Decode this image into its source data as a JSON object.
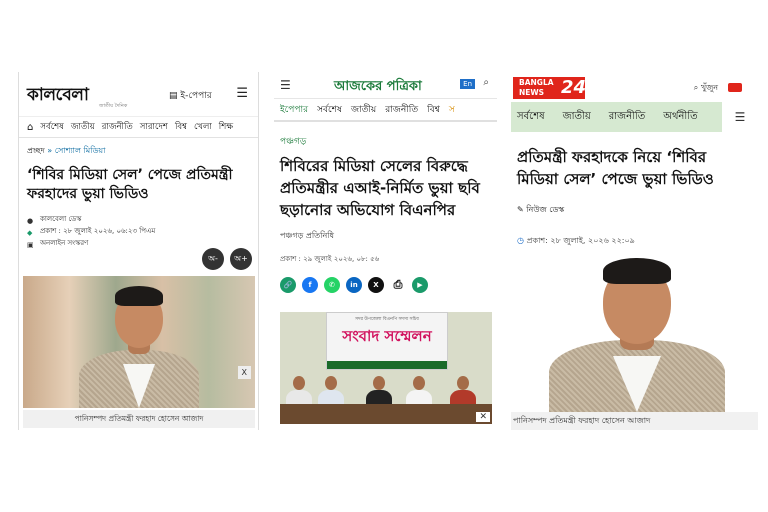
{
  "panels": {
    "kalbela": {
      "logo": "কালবেলা",
      "logo_tag": "জাতীয় দৈনিক",
      "epaper": "ই-পেপার",
      "nav": [
        "সর্বশেষ",
        "জাতীয়",
        "রাজনীতি",
        "সারাদেশ",
        "বিশ্ব",
        "খেলা",
        "শিক্ষ"
      ],
      "breadcrumb_home": "প্রচ্ছদ",
      "breadcrumb_sep": "»",
      "breadcrumb_cat": "সোশ্যাল মিডিয়া",
      "title": "‘শিবির মিডিয়া সেল’ পেজে প্রতিমন্ত্রী ফরহাদের ভুয়া ভিডিও",
      "author": "কালবেলা ডেস্ক",
      "published": "প্রকাশ : ২৮ জুলাই ২০২৬, ০৬:২৩ পিএম",
      "edition": "অনলাইন সংস্করণ",
      "font_minus": "অ-",
      "font_plus": "অ+",
      "close": "X",
      "caption": "পানিসম্পদ প্রতিমন্ত্রী ফরহাদ হোসেন আজাদ"
    },
    "ajker_patrika": {
      "logo": "আজকের পত্রিকা",
      "lang": "En",
      "nav": [
        "ইপেপার",
        "সর্বশেষ",
        "জাতীয়",
        "রাজনীতি",
        "বিশ্ব",
        "স"
      ],
      "category": "পঞ্চগড়",
      "title": "শিবিরের মিডিয়া সেলের বিরুদ্ধে প্রতিমন্ত্রীর এআই-নির্মিত ভুয়া ছবি ছড়ানোর অভিযোগ বিএনপির",
      "author": "পঞ্চগড় প্রতিনিধি",
      "published": "প্রকাশ : ২৯ জুলাই ২০২৬, ০৮: ৫৬",
      "share": [
        "🔗",
        "f",
        "✆",
        "in",
        "X",
        "⎙",
        "▶"
      ],
      "banner_top": "সদর উপজেলা বিএনপি সদস্য সচিব",
      "banner_title": "সংবাদ সম্মেলন",
      "close": "✕"
    },
    "banglanews24": {
      "logo_top": "BANGLA",
      "logo_bottom": "NEWS",
      "logo_num": "24",
      "search": "খুঁজুন",
      "nav": [
        "সর্বশেষ",
        "জাতীয়",
        "রাজনীতি",
        "অর্থনীতি"
      ],
      "title": "প্রতিমন্ত্রী ফরহাদকে নিয়ে ‘শিবির মিডিয়া সেল’ পেজে ভুয়া ভিডিও",
      "author": "নিউজ ডেস্ক",
      "published": "প্রকাশ: ২৮ জুলাই, ২০২৬ ২২:০৯",
      "caption": "পানিসম্পদ প্রতিমন্ত্রী ফরহাদ হোসেন আজাদ"
    }
  },
  "colors": {
    "kalbela_red": "#dd2222",
    "ajker_green": "#1b7a3a",
    "banglanews_red": "#e0251b",
    "banglanews_nav": "#d6e9d1"
  }
}
